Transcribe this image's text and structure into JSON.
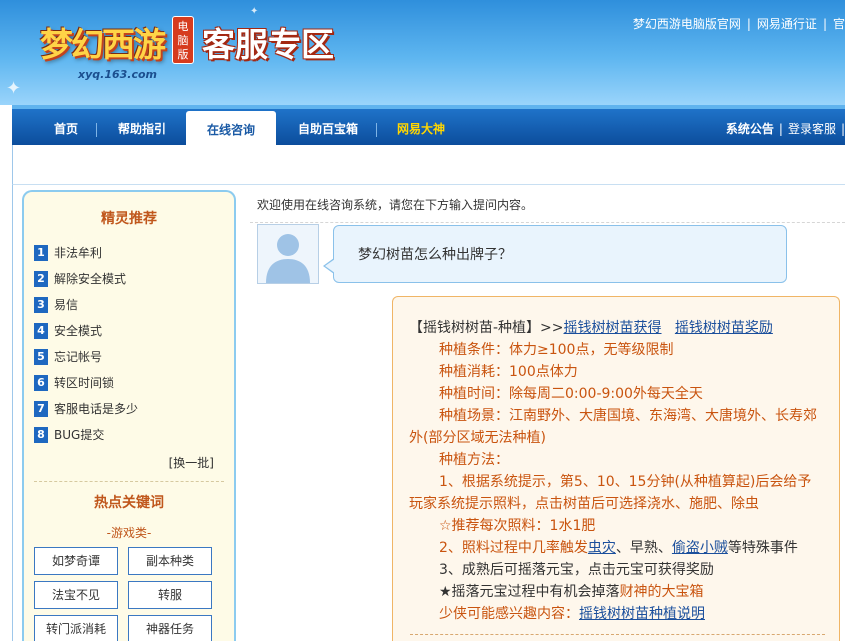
{
  "header": {
    "logo_text": "梦幻西游",
    "logo_domain": "xyq.163.com",
    "logo_badge": "电脑版",
    "title": "客服专区",
    "top_links": [
      "梦幻西游电脑版官网",
      "网易通行证",
      "官"
    ]
  },
  "nav": {
    "items": [
      {
        "label": "首页"
      },
      {
        "label": "帮助指引"
      },
      {
        "label": "在线咨询"
      },
      {
        "label": "自助百宝箱"
      },
      {
        "label": "网易大神"
      }
    ],
    "right_links": [
      "系统公告",
      "登录客服"
    ]
  },
  "sidebar": {
    "title": "精灵推荐",
    "faq": [
      {
        "num": "1",
        "label": "非法牟利"
      },
      {
        "num": "2",
        "label": "解除安全模式"
      },
      {
        "num": "3",
        "label": "易信"
      },
      {
        "num": "4",
        "label": "安全模式"
      },
      {
        "num": "5",
        "label": "忘记帐号"
      },
      {
        "num": "6",
        "label": "转区时间锁"
      },
      {
        "num": "7",
        "label": "客服电话是多少"
      },
      {
        "num": "8",
        "label": "BUG提交"
      }
    ],
    "refresh": "[换一批]",
    "hot_title": "热点关键词",
    "hot_category": "-游戏类-",
    "keywords": [
      "如梦奇谭",
      "副本种类",
      "法宝不见",
      "转服",
      "转门派消耗",
      "神器任务"
    ]
  },
  "chat": {
    "welcome": "欢迎使用在线咨询系统，请您在下方输入提问内容。",
    "question": "梦幻树苗怎么种出牌子？",
    "answer": {
      "head_prefix": "【摇钱树树苗-种植】>>",
      "head_link1": "摇钱树树苗获得",
      "head_link2": "摇钱树树苗奖励",
      "l1": "种植条件：体力≥100点，无等级限制",
      "l2": "种植消耗：100点体力",
      "l3": "种植时间：除每周二0:00-9:00外每天全天",
      "l4a": "种植场景：江南野外、大唐国境、东海湾、大唐境外、长寿郊",
      "l4b": "外(部分区域无法种植)",
      "l5": "种植方法：",
      "l6a": "1、根据系统提示，第5、10、15分钟(从种植算起)后会给予",
      "l6b": "玩家系统提示照料，点击树苗后可选择浇水、施肥、除虫",
      "l7": "☆推荐每次照料：1水1肥",
      "l8a": "2、照料过程中几率触发",
      "l8link1": "虫灾",
      "l8b": "、早熟、",
      "l8link2": "偷盗小贼",
      "l8c": "等特殊事件",
      "l9": "3、成熟后可摇落元宝，点击元宝可获得奖励",
      "l10a": "★摇落元宝过程中有机会掉落",
      "l10b": "财神的大宝箱",
      "l11a": "少侠可能感兴趣内容：",
      "l11link": "摇钱树树苗种植说明"
    }
  }
}
